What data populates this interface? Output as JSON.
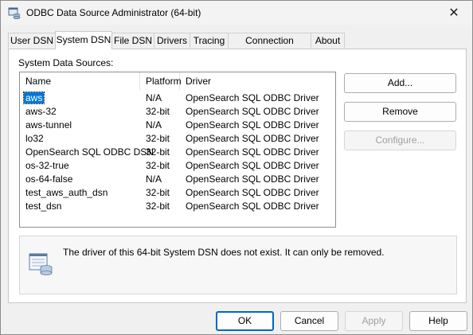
{
  "window": {
    "title": "ODBC Data Source Administrator (64-bit)",
    "close_symbol": "✕"
  },
  "tabs": [
    {
      "label": "User DSN"
    },
    {
      "label": "System DSN"
    },
    {
      "label": "File DSN"
    },
    {
      "label": "Drivers"
    },
    {
      "label": "Tracing"
    },
    {
      "label": "Connection Pooling"
    },
    {
      "label": "About"
    }
  ],
  "system_dsn": {
    "group_label": "System Data Sources:",
    "columns": [
      "Name",
      "Platform",
      "Driver"
    ],
    "rows": [
      {
        "name": "aws",
        "platform": "N/A",
        "driver": "OpenSearch SQL ODBC Driver"
      },
      {
        "name": "aws-32",
        "platform": "32-bit",
        "driver": "OpenSearch SQL ODBC Driver"
      },
      {
        "name": "aws-tunnel",
        "platform": "N/A",
        "driver": "OpenSearch SQL ODBC Driver"
      },
      {
        "name": "lo32",
        "platform": "32-bit",
        "driver": "OpenSearch SQL ODBC Driver"
      },
      {
        "name": "OpenSearch SQL ODBC DSN",
        "platform": "32-bit",
        "driver": "OpenSearch SQL ODBC Driver"
      },
      {
        "name": "os-32-true",
        "platform": "32-bit",
        "driver": "OpenSearch SQL ODBC Driver"
      },
      {
        "name": "os-64-false",
        "platform": "N/A",
        "driver": "OpenSearch SQL ODBC Driver"
      },
      {
        "name": "test_aws_auth_dsn",
        "platform": "32-bit",
        "driver": "OpenSearch SQL ODBC Driver"
      },
      {
        "name": "test_dsn",
        "platform": "32-bit",
        "driver": "OpenSearch SQL ODBC Driver"
      }
    ],
    "buttons": {
      "add": "Add...",
      "remove": "Remove",
      "configure": "Configure..."
    },
    "info_message": "The driver of this 64-bit System DSN does not exist. It can only be removed."
  },
  "footer": {
    "ok": "OK",
    "cancel": "Cancel",
    "apply": "Apply",
    "help": "Help"
  },
  "colors": {
    "selection": "#0078d7",
    "default_button_border": "#0067c0"
  }
}
